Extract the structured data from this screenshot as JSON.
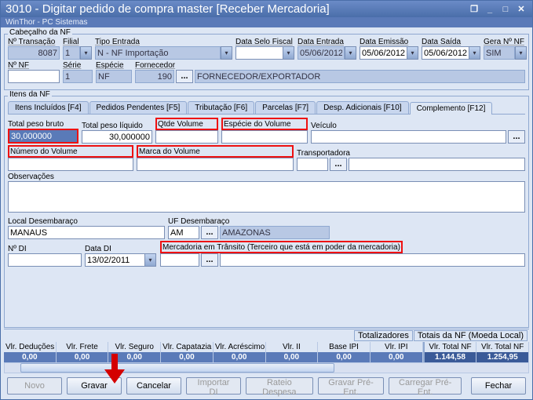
{
  "window": {
    "title": "3010 - Digitar pedido de compra master [Receber Mercadoria]",
    "subtitle": "WinThor - PC Sistemas"
  },
  "cabecalho": {
    "group_title": "Cabeçalho da NF",
    "labels": {
      "transacao": "Nº Transação",
      "filial": "Filial",
      "tipo_entrada": "Tipo Entrada",
      "data_selo": "Data Selo Fiscal",
      "data_entrada": "Data Entrada",
      "data_emissao": "Data Emissão",
      "data_saida": "Data Saída",
      "gera_nf": "Gera Nº NF",
      "nf": "Nº NF",
      "serie": "Série",
      "especie": "Espécie",
      "fornecedor": "Fornecedor"
    },
    "values": {
      "transacao": "8087",
      "filial": "1",
      "tipo_entrada": "N - NF Importação",
      "data_selo": "",
      "data_entrada": "05/06/2012",
      "data_emissao": "05/06/2012",
      "data_saida": "05/06/2012",
      "gera_nf": "SIM",
      "nf": "",
      "serie": "1",
      "especie": "NF",
      "fornecedor_code": "190",
      "fornecedor_name": "FORNECEDOR/EXPORTADOR"
    }
  },
  "itens": {
    "group_title": "Itens da NF",
    "tabs": {
      "incluidos": "Itens Incluídos [F4]",
      "pendentes": "Pedidos Pendentes [F5]",
      "tributacao": "Tributação [F6]",
      "parcelas": "Parcelas [F7]",
      "desp": "Desp. Adicionais [F10]",
      "complemento": "Complemento [F12]"
    },
    "complemento": {
      "labels": {
        "peso_bruto": "Total peso bruto",
        "peso_liquido": "Total peso líquido",
        "qtde_volume": "Qtde Volume",
        "especie_volume": "Espécie do Volume",
        "veiculo": "Veículo",
        "numero_volume": "Número do Volume",
        "marca_volume": "Marca do Volume",
        "transportadora": "Transportadora",
        "observacoes": "Observações",
        "local_desembaraco": "Local Desembaraço",
        "uf_desembaraco": "UF Desembaraço",
        "uf_nome": "AMAZONAS",
        "no_di": "Nº DI",
        "data_di": "Data DI",
        "mercadoria_transito": "Mercadoria em Trânsito (Terceiro que está em poder da mercadoria)"
      },
      "values": {
        "peso_bruto": "30,000000",
        "peso_liquido": "30,000000",
        "qtde_volume": "",
        "especie_volume": "",
        "veiculo": "",
        "numero_volume": "",
        "marca_volume": "",
        "transportadora_code": "",
        "transportadora_name": "",
        "observacoes": "",
        "local_desembaraco": "MANAUS",
        "uf_desembaraco": "AM",
        "no_di": "",
        "data_di": "13/02/2011",
        "mercadoria_code": "",
        "mercadoria_name": ""
      }
    }
  },
  "totalizadores": {
    "group1": "Totalizadores",
    "group2": "Totais da NF (Moeda Local)",
    "headers": {
      "deducoes": "Vlr. Deduções",
      "frete": "Vlr. Frete",
      "seguro": "Vlr. Seguro",
      "capatazia": "Vlr. Capatazia",
      "acrescimo": "Vlr. Acréscimo",
      "ii": "Vlr. II",
      "base_ipi": "Base IPI",
      "ipi": "Vlr. IPI",
      "total_nf1": "Vlr. Total NF",
      "total_nf2": "Vlr. Total NF"
    },
    "values": {
      "deducoes": "0,00",
      "frete": "0,00",
      "seguro": "0,00",
      "capatazia": "0,00",
      "acrescimo": "0,00",
      "ii": "0,00",
      "base_ipi": "0,00",
      "ipi": "0,00",
      "total_nf1": "1.144,58",
      "total_nf2": "1.254,95"
    }
  },
  "buttons": {
    "novo": "Novo",
    "gravar": "Gravar",
    "cancelar": "Cancelar",
    "importar_di": "Importar DI",
    "rateio": "Rateio Despesa",
    "gravar_pre": "Gravar Pré-Ent.",
    "carregar_pre": "Carregar Pré-Ent.",
    "fechar": "Fechar"
  },
  "icons": {
    "dots": "...",
    "dropdown": "▾"
  }
}
